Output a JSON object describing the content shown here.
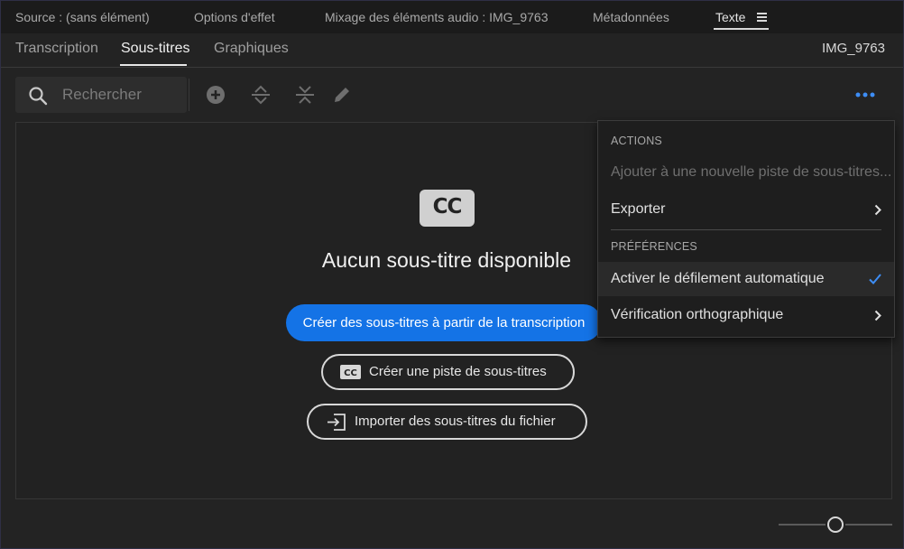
{
  "panel_tabs": [
    {
      "label": "Source : (sans élément)"
    },
    {
      "label": "Options d'effet"
    },
    {
      "label": "Mixage des éléments audio : IMG_9763"
    },
    {
      "label": "Métadonnées"
    },
    {
      "label": "Texte"
    }
  ],
  "sub_tabs": [
    {
      "label": "Transcription"
    },
    {
      "label": "Sous-titres"
    },
    {
      "label": "Graphiques"
    }
  ],
  "clip_name": "IMG_9763",
  "search": {
    "placeholder": "Rechercher",
    "value": ""
  },
  "toolbar": {
    "icons": [
      "add-circle-icon",
      "expand-icon",
      "collapse-icon",
      "pencil-icon",
      "more-icon"
    ]
  },
  "empty_state": {
    "logo_text": "CC",
    "title": "Aucun sous-titre disponible",
    "primary_button": "Créer des sous-titres à partir de la transcription",
    "create_track_button": "Créer une piste de sous-titres",
    "import_button": "Importer des sous-titres du fichier"
  },
  "menu": {
    "actions_header": "ACTIONS",
    "add_track": "Ajouter à une nouvelle piste de sous-titres...",
    "export": "Exporter",
    "preferences_header": "PRÉFÉRENCES",
    "auto_scroll": "Activer le défilement automatique",
    "auto_scroll_checked": true,
    "spell_check": "Vérification orthographique"
  },
  "colors": {
    "accent": "#1473e6",
    "background": "#232323",
    "menu_background": "#1e1e1e"
  }
}
